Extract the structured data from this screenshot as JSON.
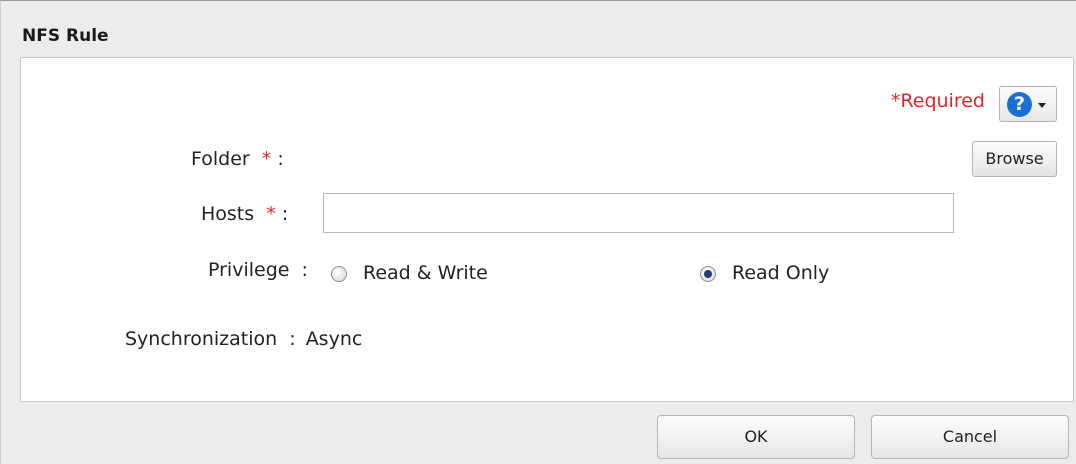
{
  "dialog": {
    "title": "NFS Rule",
    "required_label": "*Required",
    "help_icon_glyph": "?",
    "form": {
      "folder_label": "Folder",
      "hosts_label": "Hosts",
      "privilege_label": "Privilege",
      "sync_label": "Synchronization",
      "required_star": "*",
      "colon": ":",
      "browse_label": "Browse",
      "hosts_value": "",
      "privilege_options": [
        "Read & Write",
        "Read Only"
      ],
      "privilege_selected": "Read Only",
      "sync_value": "Async"
    },
    "buttons": {
      "ok": "OK",
      "cancel": "Cancel"
    }
  },
  "colors": {
    "required": "#e0262f",
    "help_accent": "#1a6fd6"
  },
  "icons": [
    "help-icon",
    "caret-down-icon"
  ]
}
